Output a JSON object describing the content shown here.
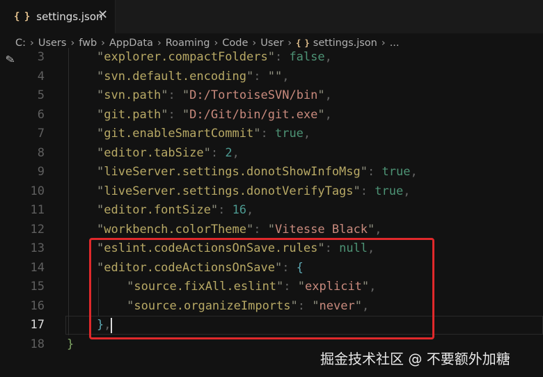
{
  "tab": {
    "title": "settings.json",
    "icon": "json-curly-icon",
    "close_glyph": "✕"
  },
  "breadcrumb": {
    "items": [
      "C:",
      "Users",
      "fwb",
      "AppData",
      "Roaming",
      "Code",
      "User",
      "settings.json",
      "..."
    ],
    "separator": "›"
  },
  "editor": {
    "active_line": 17,
    "line_numbers": [
      "3",
      "4",
      "5",
      "6",
      "7",
      "8",
      "9",
      "10",
      "11",
      "12",
      "13",
      "14",
      "15",
      "16",
      "17",
      "18"
    ],
    "lines": [
      [
        [
          "q",
          "\""
        ],
        [
          "key",
          "explorer.compactFolders"
        ],
        [
          "q",
          "\""
        ],
        [
          "punct",
          ": "
        ],
        [
          "bool",
          "false"
        ],
        [
          "punct",
          ","
        ]
      ],
      [
        [
          "q",
          "\""
        ],
        [
          "key",
          "svn.default.encoding"
        ],
        [
          "q",
          "\""
        ],
        [
          "punct",
          ": "
        ],
        [
          "q",
          "\"\""
        ],
        [
          "punct",
          ","
        ]
      ],
      [
        [
          "q",
          "\""
        ],
        [
          "key",
          "svn.path"
        ],
        [
          "q",
          "\""
        ],
        [
          "punct",
          ": "
        ],
        [
          "q",
          "\""
        ],
        [
          "str",
          "D:/TortoiseSVN/bin"
        ],
        [
          "q",
          "\""
        ],
        [
          "punct",
          ","
        ]
      ],
      [
        [
          "q",
          "\""
        ],
        [
          "key",
          "git.path"
        ],
        [
          "q",
          "\""
        ],
        [
          "punct",
          ": "
        ],
        [
          "q",
          "\""
        ],
        [
          "str",
          "D:/Git/bin/git.exe"
        ],
        [
          "q",
          "\""
        ],
        [
          "punct",
          ","
        ]
      ],
      [
        [
          "q",
          "\""
        ],
        [
          "key",
          "git.enableSmartCommit"
        ],
        [
          "q",
          "\""
        ],
        [
          "punct",
          ": "
        ],
        [
          "bool",
          "true"
        ],
        [
          "punct",
          ","
        ]
      ],
      [
        [
          "q",
          "\""
        ],
        [
          "key",
          "editor.tabSize"
        ],
        [
          "q",
          "\""
        ],
        [
          "punct",
          ": "
        ],
        [
          "num",
          "2"
        ],
        [
          "punct",
          ","
        ]
      ],
      [
        [
          "q",
          "\""
        ],
        [
          "key",
          "liveServer.settings.donotShowInfoMsg"
        ],
        [
          "q",
          "\""
        ],
        [
          "punct",
          ": "
        ],
        [
          "bool",
          "true"
        ],
        [
          "punct",
          ","
        ]
      ],
      [
        [
          "q",
          "\""
        ],
        [
          "key",
          "liveServer.settings.donotVerifyTags"
        ],
        [
          "q",
          "\""
        ],
        [
          "punct",
          ": "
        ],
        [
          "bool",
          "true"
        ],
        [
          "punct",
          ","
        ]
      ],
      [
        [
          "q",
          "\""
        ],
        [
          "key",
          "editor.fontSize"
        ],
        [
          "q",
          "\""
        ],
        [
          "punct",
          ": "
        ],
        [
          "num",
          "16"
        ],
        [
          "punct",
          ","
        ]
      ],
      [
        [
          "q",
          "\""
        ],
        [
          "key",
          "workbench.colorTheme"
        ],
        [
          "q",
          "\""
        ],
        [
          "punct",
          ": "
        ],
        [
          "q",
          "\""
        ],
        [
          "str",
          "Vitesse Black"
        ],
        [
          "q",
          "\""
        ],
        [
          "punct",
          ","
        ]
      ],
      [
        [
          "q",
          "\""
        ],
        [
          "key",
          "eslint.codeActionsOnSave.rules"
        ],
        [
          "q",
          "\""
        ],
        [
          "punct",
          ": "
        ],
        [
          "bool",
          "null"
        ],
        [
          "punct",
          ","
        ]
      ],
      [
        [
          "q",
          "\""
        ],
        [
          "key",
          "editor.codeActionsOnSave"
        ],
        [
          "q",
          "\""
        ],
        [
          "punct",
          ": "
        ],
        [
          "brace2",
          "{"
        ]
      ],
      [
        [
          "q",
          "\""
        ],
        [
          "key",
          "source.fixAll.eslint"
        ],
        [
          "q",
          "\""
        ],
        [
          "punct",
          ": "
        ],
        [
          "q",
          "\""
        ],
        [
          "str",
          "explicit"
        ],
        [
          "q",
          "\""
        ],
        [
          "punct",
          ","
        ]
      ],
      [
        [
          "q",
          "\""
        ],
        [
          "key",
          "source.organizeImports"
        ],
        [
          "q",
          "\""
        ],
        [
          "punct",
          ": "
        ],
        [
          "q",
          "\""
        ],
        [
          "str",
          "never"
        ],
        [
          "q",
          "\""
        ],
        [
          "punct",
          ","
        ]
      ],
      [
        [
          "brace2",
          "}"
        ],
        [
          "punct",
          ","
        ]
      ],
      [
        [
          "brace",
          "}"
        ]
      ]
    ],
    "indents": [
      1,
      1,
      1,
      1,
      1,
      1,
      1,
      1,
      1,
      1,
      1,
      1,
      2,
      2,
      1,
      0
    ]
  },
  "watermark": "掘金技术社区 @ 不要额外加糖",
  "colors": {
    "background": "#121212",
    "highlight_box": "#e0292b",
    "key": "#b8a965",
    "string": "#c98a7d",
    "boolean": "#4d9375",
    "number": "#4c9a91"
  }
}
